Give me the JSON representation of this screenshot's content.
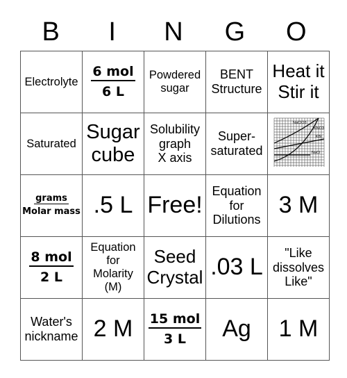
{
  "header": {
    "letters": [
      "B",
      "I",
      "N",
      "G",
      "O"
    ]
  },
  "cells": {
    "r0c0": "Electrolyte",
    "r0c1": {
      "numerator": "6 mol",
      "denominator": "6 L"
    },
    "r0c2": [
      "Powdered",
      "sugar"
    ],
    "r0c3": [
      "BENT",
      "Structure"
    ],
    "r0c4": [
      "Heat it",
      "Stir it"
    ],
    "r1c0": "Saturated",
    "r1c1": [
      "Sugar",
      "cube"
    ],
    "r1c2": [
      "Solubility",
      "graph",
      "X axis"
    ],
    "r1c3": [
      "Super-",
      "saturated"
    ],
    "r1c4": {
      "image": "solubility-curve-graph",
      "labels": [
        "NaClO3",
        "KNO3",
        "KBr",
        "NaCl"
      ]
    },
    "r2c0": {
      "numerator": "grams",
      "denominator": "Molar mass"
    },
    "r2c1": ".5 L",
    "r2c2": "Free!",
    "r2c3": [
      "Equation",
      "for",
      "Dilutions"
    ],
    "r2c4": "3 M",
    "r3c0": {
      "numerator": "8 mol",
      "denominator": "2 L"
    },
    "r3c1": [
      "Equation",
      "for",
      "Molarity",
      "(M)"
    ],
    "r3c2": [
      "Seed",
      "Crystal"
    ],
    "r3c3": ".03 L",
    "r3c4": [
      "\"Like",
      "dissolves",
      "Like\""
    ],
    "r4c0": [
      "Water's",
      "nickname"
    ],
    "r4c1": "2 M",
    "r4c2": {
      "numerator": "15 mol",
      "denominator": "3 L"
    },
    "r4c3": "Ag",
    "r4c4": "1 M"
  }
}
